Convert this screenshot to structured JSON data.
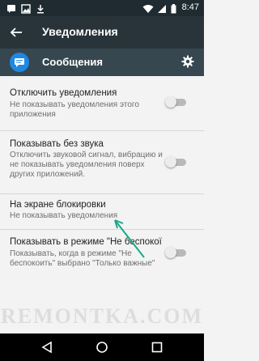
{
  "status_bar": {
    "time": "8:47",
    "icons": [
      "message-icon",
      "image-icon",
      "download-icon",
      "wifi-icon",
      "signal-icon",
      "battery-icon"
    ]
  },
  "toolbar": {
    "title": "Уведомления",
    "back_icon": "arrow-back-icon"
  },
  "app_header": {
    "name": "Сообщения",
    "icon": "messages-icon",
    "settings_icon": "gear-icon",
    "accent": "#1e88e5"
  },
  "settings": [
    {
      "title": "Отключить уведомления",
      "subtitle": "Не показывать уведомления этого приложения",
      "toggle": false
    },
    {
      "title": "Показывать без звука",
      "subtitle": "Отключить звуковой сигнал, вибрацию и не показывать уведомления поверх других приложений.",
      "toggle": false
    },
    {
      "title": "На экране блокировки",
      "subtitle": "Не показывать уведомления"
    },
    {
      "title": "Показывать в режиме \"Не беспокої",
      "subtitle": "Показывать, когда в режиме \"Не беспокоить\" выбрано \"Только важные\"",
      "toggle": false
    }
  ],
  "annotation": {
    "arrow_color": "#19a98a"
  },
  "nav_bar": {
    "icons": [
      "back-triangle-icon",
      "home-circle-icon",
      "recents-square-icon"
    ]
  },
  "watermark": "REMONTKA.COM"
}
